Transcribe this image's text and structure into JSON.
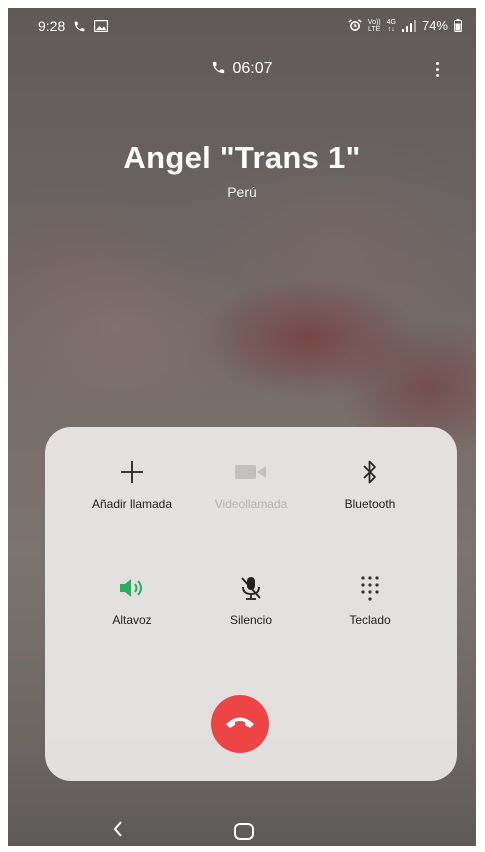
{
  "status_bar": {
    "time": "9:28",
    "volte_top": "Vo))",
    "volte_bottom": "LTE",
    "net_top": "4G",
    "net_bottom": "↑↓",
    "battery": "74%"
  },
  "call": {
    "timer": "06:07",
    "contact_name": "Angel \"Trans 1\"",
    "country": "Perú"
  },
  "controls": {
    "add_call": "Añadir llamada",
    "video_call": "Videollamada",
    "bluetooth": "Bluetooth",
    "speaker": "Altavoz",
    "mute": "Silencio",
    "keypad": "Teclado"
  },
  "colors": {
    "speaker_active": "#27ae60",
    "end_call": "#ec4545",
    "disabled": "#c4c0bf"
  },
  "icons": [
    "phone-icon",
    "gallery-icon",
    "alarm-icon",
    "signal-icon",
    "battery-icon",
    "more-icon",
    "plus-icon",
    "video-camera-icon",
    "bluetooth-icon",
    "speaker-icon",
    "mic-off-icon",
    "dialpad-icon",
    "end-call-icon",
    "back-icon",
    "home-icon"
  ]
}
